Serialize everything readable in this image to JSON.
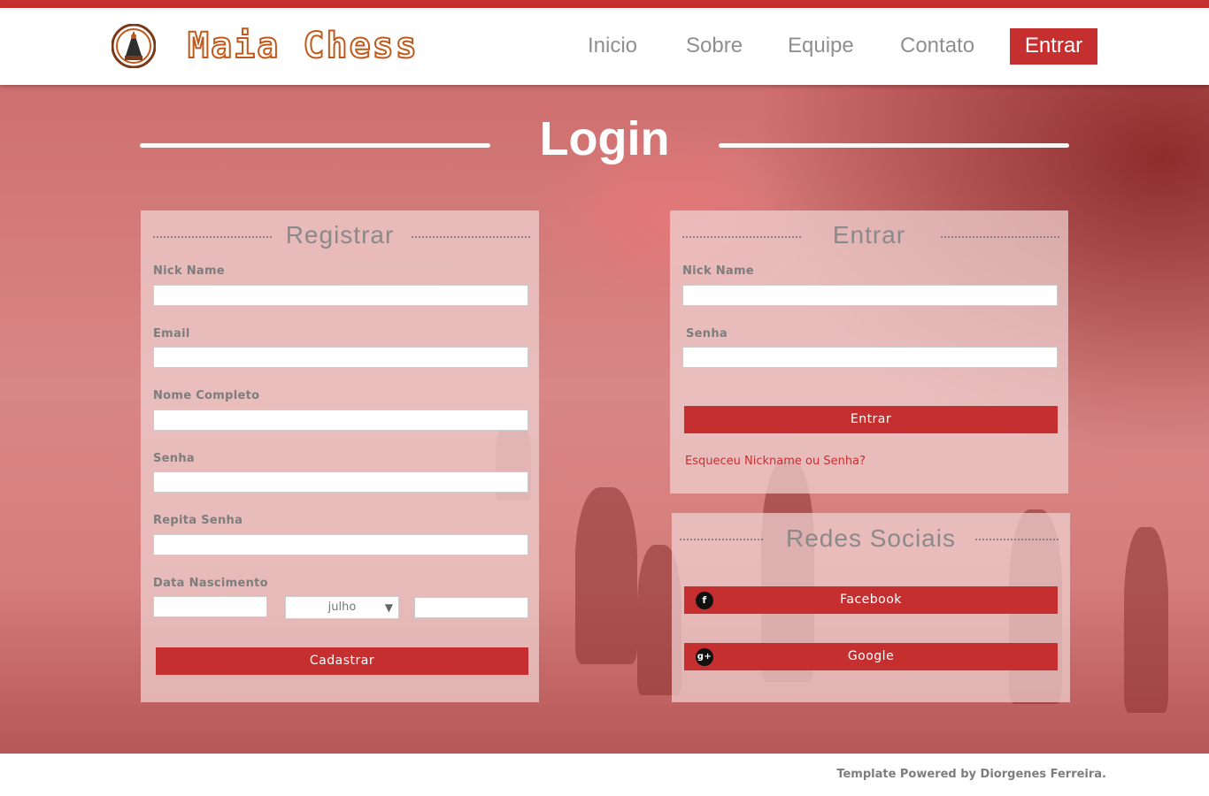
{
  "brand": {
    "name": "Maia Chess",
    "accent": "#c62f2f",
    "logo_color": "#c0591a"
  },
  "nav": {
    "items": [
      "Inicio",
      "Sobre",
      "Equipe",
      "Contato"
    ],
    "cta": "Entrar"
  },
  "hero": {
    "title": "Login"
  },
  "register": {
    "title": "Registrar",
    "labels": {
      "nickname": "Nick Name",
      "email": "Email",
      "fullname": "Nome Completo",
      "password": "Senha",
      "repeat_password": "Repita Senha",
      "birthdate": "Data Nascimento"
    },
    "values": {
      "nickname": "",
      "email": "",
      "fullname": "",
      "password": "",
      "repeat_password": "",
      "day": "",
      "month": "julho",
      "year": ""
    },
    "submit": "Cadastrar"
  },
  "login": {
    "title": "Entrar",
    "labels": {
      "nickname": "Nick Name",
      "password": "Senha"
    },
    "submit": "Entrar",
    "forgot": "Esqueceu Nickname ou Senha?"
  },
  "social": {
    "title": "Redes Sociais",
    "facebook": {
      "label": "Facebook",
      "icon": "facebook-icon"
    },
    "google": {
      "label": "Google",
      "icon": "google-plus-icon"
    }
  },
  "footer": {
    "credit": "Template Powered by Diorgenes Ferreira."
  }
}
